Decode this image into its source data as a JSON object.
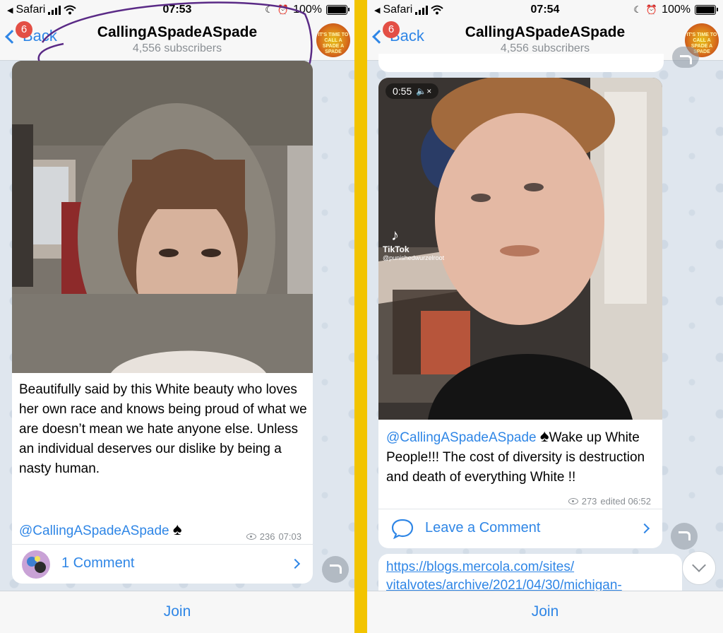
{
  "left": {
    "status": {
      "carrier": "Safari",
      "time": "07:53",
      "battery": "100%"
    },
    "nav": {
      "back_label": "Back",
      "badge": "6",
      "title": "CallingASpadeASpade",
      "subtitle": "4,556 subscribers"
    },
    "avatar_text": "IT'S TIME TO CALL A SPADE A SPADE",
    "post": {
      "text": "Beautifully said by this White beauty who loves her own race and knows being proud of what we are doesn’t mean we hate anyone else. Unless an individual deserves our dislike by being a nasty human.",
      "mention": "@CallingASpadeASpade",
      "suit": "♠",
      "views": "236",
      "time": "07:03",
      "comment_label": "1 Comment"
    },
    "join_label": "Join"
  },
  "right": {
    "status": {
      "carrier": "Safari",
      "time": "07:54",
      "battery": "100%"
    },
    "nav": {
      "back_label": "Back",
      "badge": "6",
      "title": "CallingASpadeASpade",
      "subtitle": "4,556 subscribers"
    },
    "avatar_text": "IT'S TIME TO CALL A SPADE A SPADE",
    "post": {
      "duration": "0:55",
      "tiktok_label": "TikTok",
      "tiktok_user": "@punishedwurzelroot",
      "mention": "@CallingASpadeASpade",
      "suit": "♠",
      "text": "Wake up White People!!! The cost of diversity is destruction and death of everything White !!",
      "views": "273",
      "time": "edited 06:52",
      "comment_label": "Leave a Comment"
    },
    "link_line1": "https://blogs.mercola.com/sites/",
    "link_line2": "vitalvotes/archive/2021/04/30/michigan-",
    "join_label": "Join"
  }
}
